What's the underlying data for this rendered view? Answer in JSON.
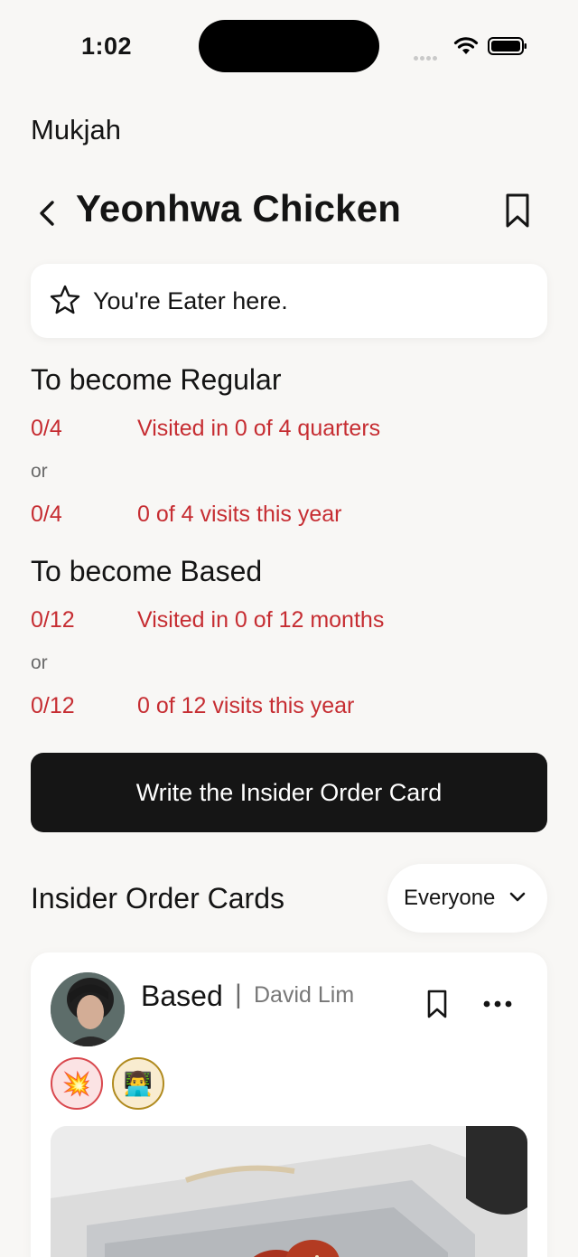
{
  "status_bar": {
    "time": "1:02"
  },
  "header": {
    "app_name": "Mukjah",
    "title": "Yeonhwa Chicken"
  },
  "status_card": {
    "text": "You're Eater here."
  },
  "regular": {
    "title": "To become Regular",
    "rows": [
      {
        "value": "0/4",
        "desc": "Visited in 0 of 4 quarters"
      },
      {
        "value": "0/4",
        "desc": "0 of 4 visits this year"
      }
    ],
    "or": "or"
  },
  "based": {
    "title": "To become Based",
    "rows": [
      {
        "value": "0/12",
        "desc": "Visited in 0 of 12 months"
      },
      {
        "value": "0/12",
        "desc": "0 of 12 visits this year"
      }
    ],
    "or": "or"
  },
  "write_button": {
    "label": "Write the Insider Order Card"
  },
  "cards_section": {
    "title": "Insider Order Cards",
    "filter": "Everyone"
  },
  "order_card": {
    "level": "Based",
    "separator": "|",
    "author": "David Lim",
    "badges": [
      "💥",
      "👨‍💻"
    ]
  },
  "colors": {
    "accent_red": "#c62d32",
    "button_dark": "#151515",
    "background": "#f8f7f5"
  },
  "icons": [
    "back-chevron-icon",
    "bookmark-icon",
    "star-icon",
    "chevron-down-icon",
    "more-icon",
    "wifi-icon",
    "battery-icon",
    "signal-icon"
  ]
}
